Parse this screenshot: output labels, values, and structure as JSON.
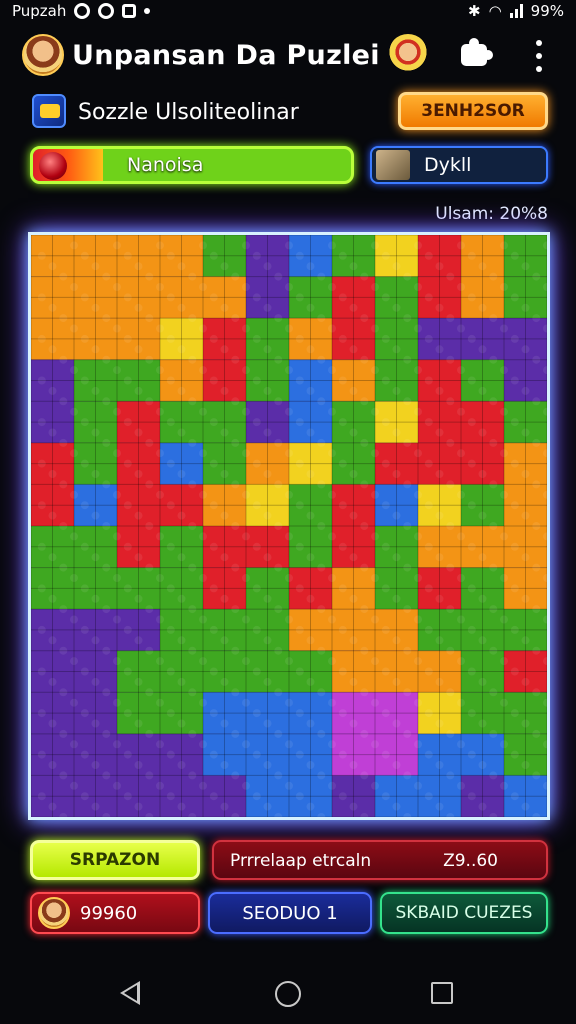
{
  "status_bar": {
    "app_name": "Pupzah",
    "battery": "99%"
  },
  "header": {
    "title": "Unpansan Da Puzlei"
  },
  "subheader": {
    "subtitle": "Sozzle Ulsoliteolinar",
    "action_label": "3ENH2SOR"
  },
  "progress": {
    "label": "Nanoisa",
    "level_fraction": 0.22
  },
  "daily": {
    "label": "Dykll"
  },
  "usage_text": "Ulsam: 20%8",
  "board": {
    "colors": {
      "orange": "#f39415",
      "yellow": "#f2d21f",
      "green": "#3fa821",
      "red": "#e0202a",
      "purple": "#5b2da8",
      "blue": "#2c6fe0",
      "magenta": "#c03fd6"
    }
  },
  "bottom_row1": {
    "left_label": "SRPAZON",
    "middle_label": "Prrrelaap etrcaln",
    "middle_value": "Z9..60"
  },
  "bottom_row2": {
    "score": "99960",
    "second_label": "SEODUO 1",
    "third_label": "SKBAID CUEZES"
  },
  "nav": {
    "icons": [
      "back-icon",
      "home-icon",
      "recent-apps-icon"
    ]
  }
}
